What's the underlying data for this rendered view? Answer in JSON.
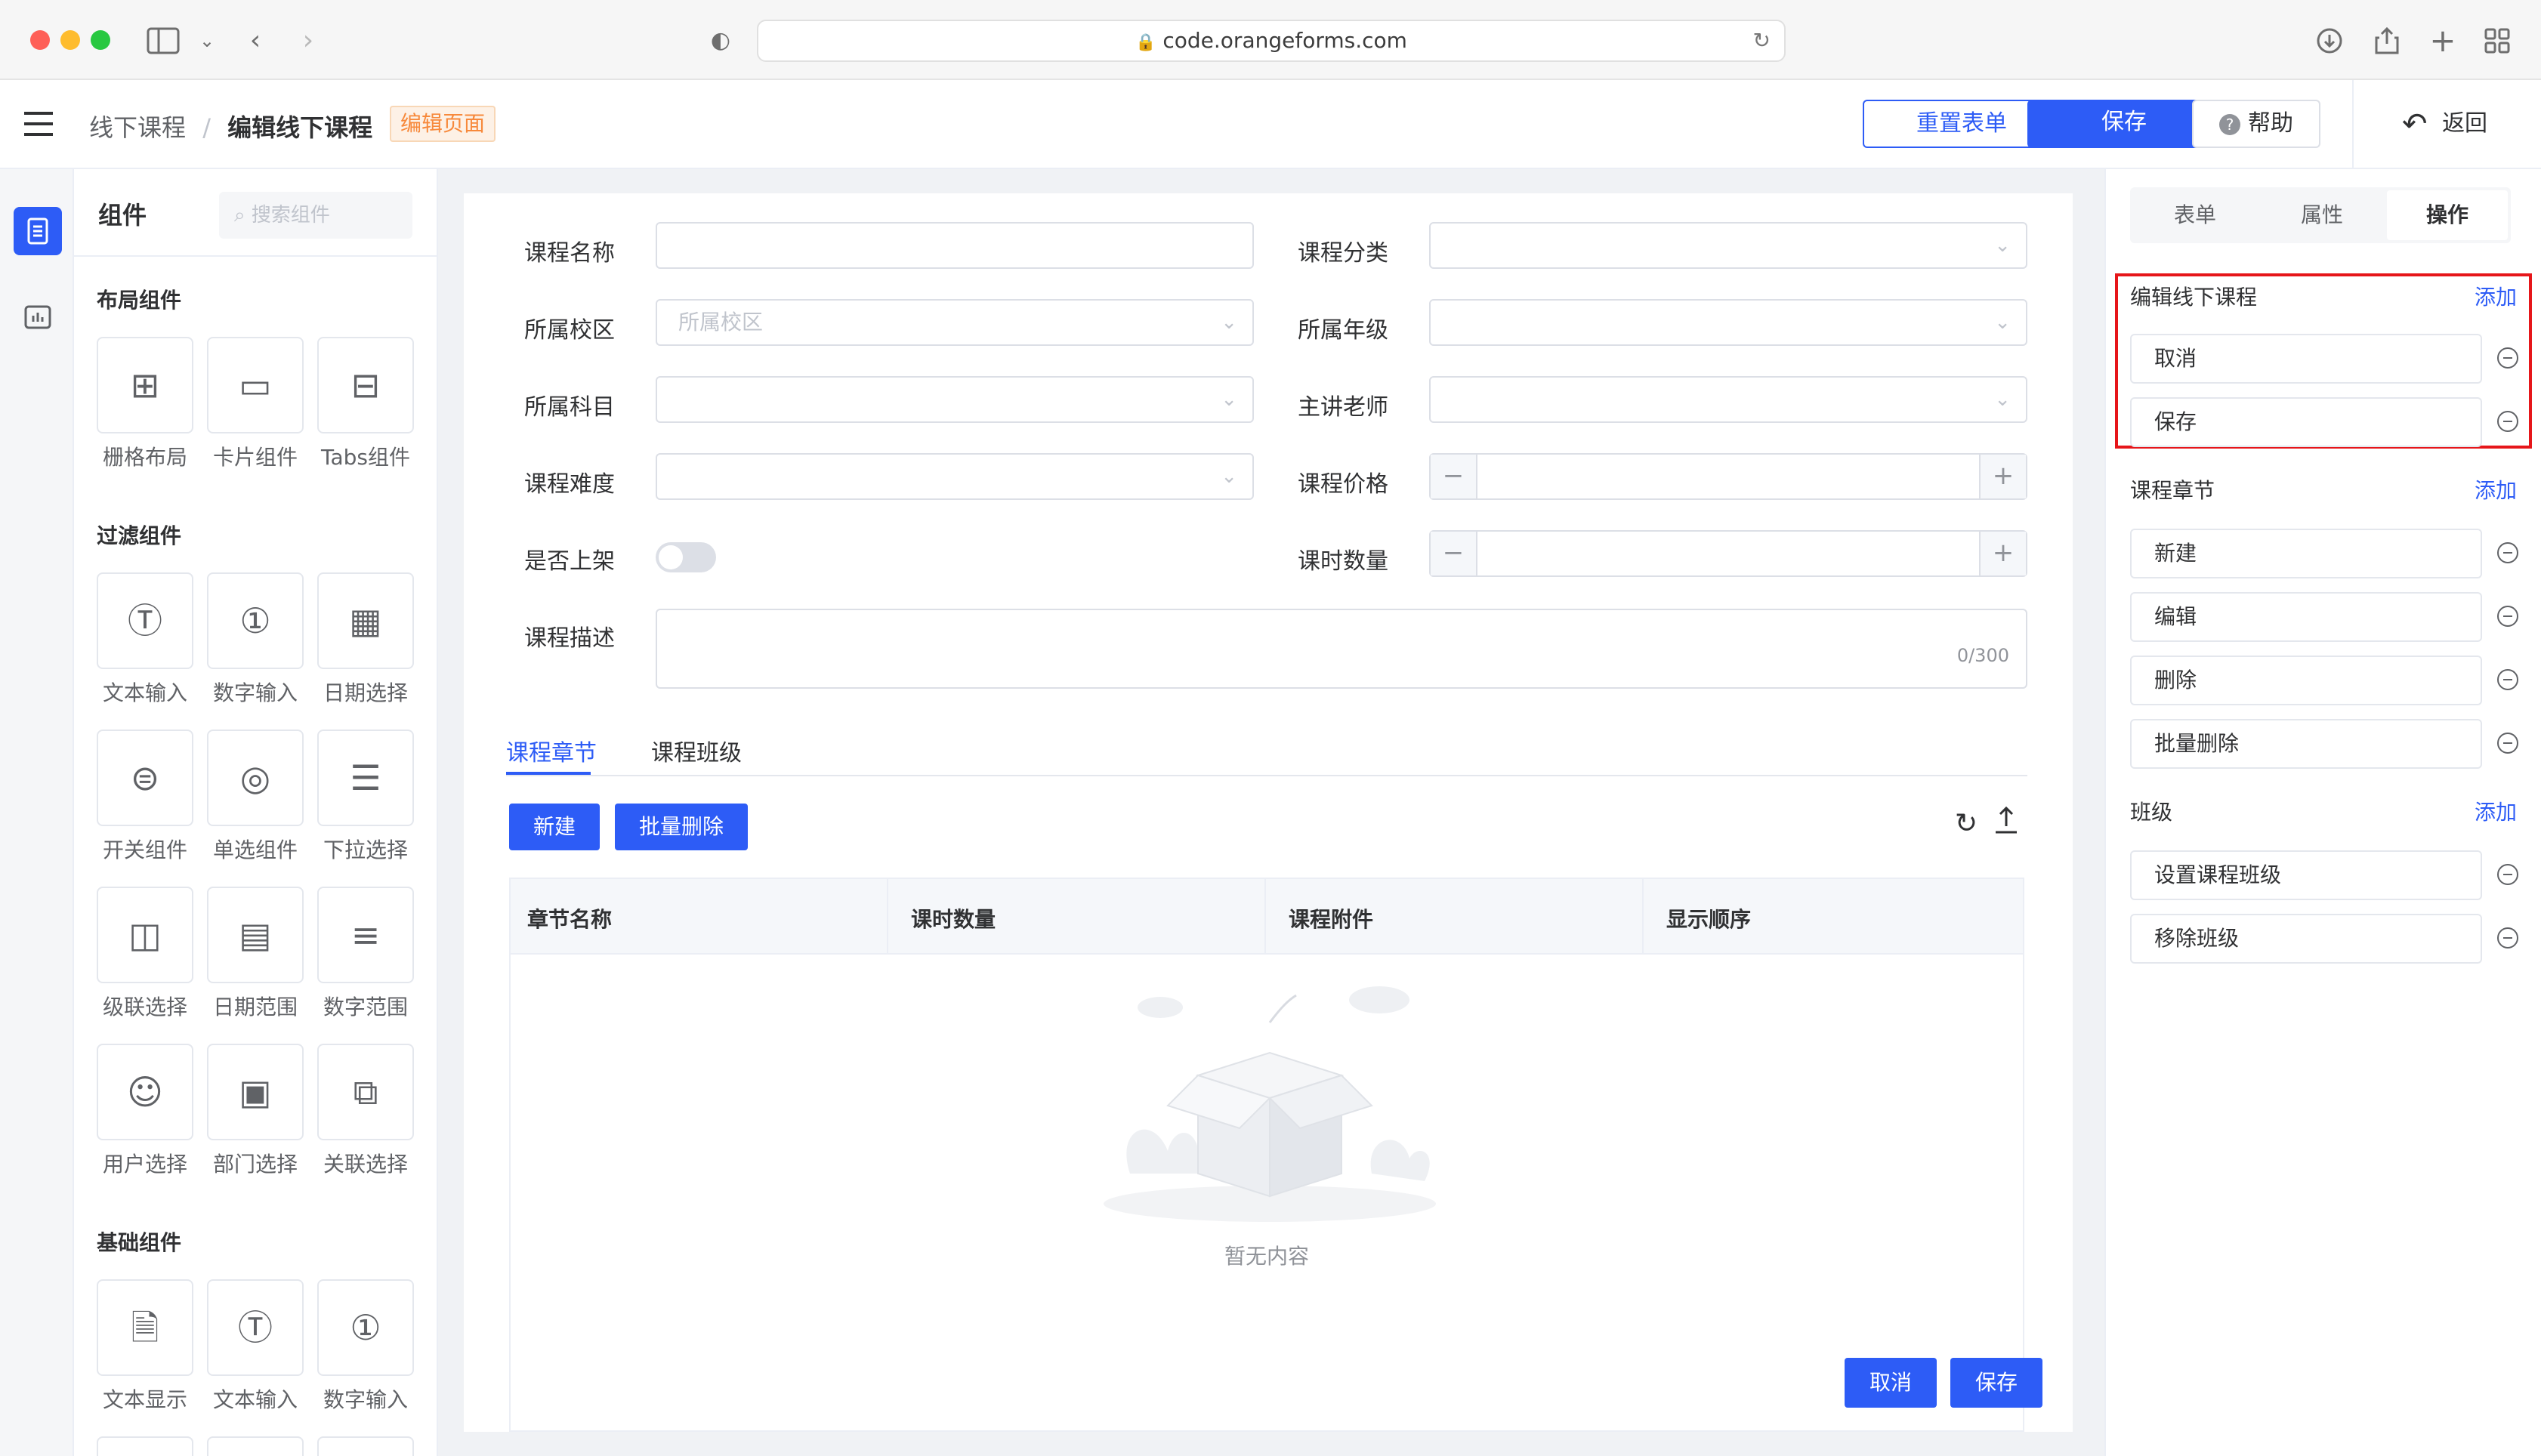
{
  "browser": {
    "url": "code.orangeforms.com",
    "traffic_lights": {
      "close": "#fe5f57",
      "minimize": "#febc2e",
      "zoom": "#28c840"
    }
  },
  "header": {
    "breadcrumb_parent": "线下课程",
    "breadcrumb_sep": "/",
    "title": "编辑线下课程",
    "badge": "编辑页面",
    "reset_label": "重置表单",
    "save_label": "保存",
    "help_label": "帮助",
    "back_label": "返回"
  },
  "components": {
    "title": "组件",
    "search_placeholder": "搜索组件",
    "groups": [
      {
        "title": "布局组件",
        "items": [
          "栅格布局",
          "卡片组件",
          "Tabs组件"
        ]
      },
      {
        "title": "过滤组件",
        "items": [
          "文本输入",
          "数字输入",
          "日期选择",
          "开关组件",
          "单选组件",
          "下拉选择",
          "级联选择",
          "日期范围",
          "数字范围",
          "用户选择",
          "部门选择",
          "关联选择"
        ]
      },
      {
        "title": "基础组件",
        "items": [
          "文本显示",
          "文本输入",
          "数字输入"
        ]
      }
    ]
  },
  "form": {
    "course_name": "课程名称",
    "course_category": "课程分类",
    "campus": "所属校区",
    "campus_placeholder": "所属校区",
    "grade": "所属年级",
    "subject": "所属科目",
    "teacher": "主讲老师",
    "difficulty": "课程难度",
    "price": "课程价格",
    "on_shelf": "是否上架",
    "lesson_count": "课时数量",
    "description": "课程描述",
    "char_count": "0/300"
  },
  "tabs": [
    "课程章节",
    "课程班级"
  ],
  "table": {
    "new_label": "新建",
    "batch_delete_label": "批量删除",
    "columns": [
      "章节名称",
      "课时数量",
      "课程附件",
      "显示顺序"
    ],
    "empty_text": "暂无内容"
  },
  "footer": {
    "cancel_label": "取消",
    "save_label": "保存"
  },
  "right_panel": {
    "tabs": [
      "表单",
      "属性",
      "操作"
    ],
    "active_tab": "操作",
    "sections": [
      {
        "title": "编辑线下课程",
        "add_label": "添加",
        "items": [
          "取消",
          "保存"
        ]
      },
      {
        "title": "课程章节",
        "add_label": "添加",
        "items": [
          "新建",
          "编辑",
          "删除",
          "批量删除"
        ]
      },
      {
        "title": "班级",
        "add_label": "添加",
        "items": [
          "设置课程班级",
          "移除班级"
        ]
      }
    ]
  },
  "colors": {
    "primary": "#2d5cf6",
    "highlight": "#e6161a",
    "badge": "#f7893b"
  }
}
